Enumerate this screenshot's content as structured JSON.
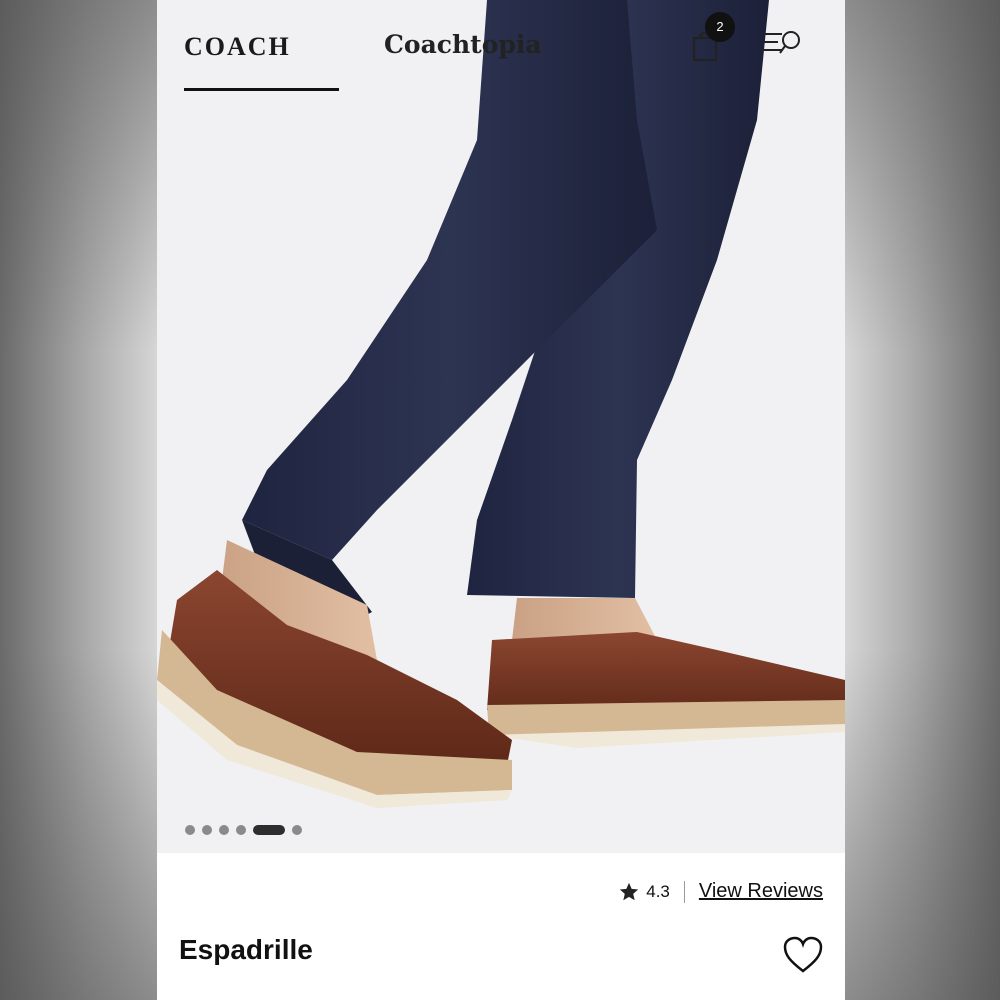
{
  "header": {
    "brand": "COACH",
    "tab_secondary": "Coachtopia",
    "cart_count": "2"
  },
  "icons": {
    "cart": "shopping-bag-icon",
    "menu_search": "menu-search-icon",
    "star": "star-icon",
    "wishlist": "heart-icon"
  },
  "carousel": {
    "total": 6,
    "active_index": 4
  },
  "product": {
    "rating": "4.3",
    "reviews_link": "View Reviews",
    "name": "Espadrille"
  },
  "colors": {
    "leather": "#7a3a27",
    "denim": "#262c47",
    "jute": "#d2b690"
  }
}
